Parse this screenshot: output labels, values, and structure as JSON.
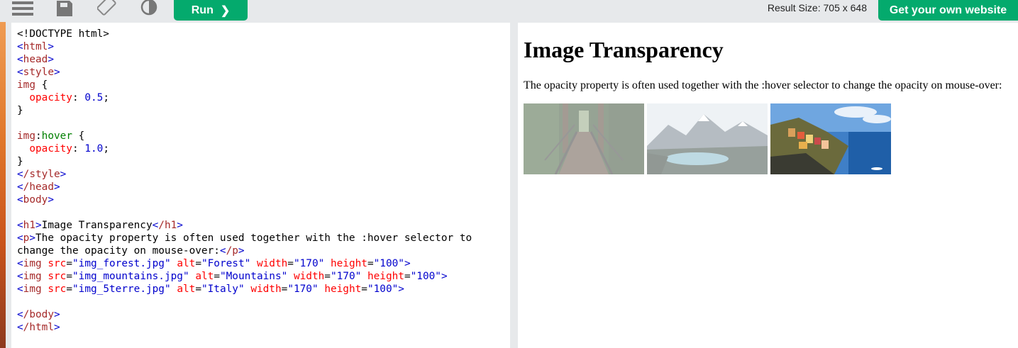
{
  "toolbar": {
    "icons": [
      "menu-icon",
      "save-icon",
      "rotate-icon",
      "contrast-icon"
    ],
    "run_label": "Run",
    "result_size": "Result Size: 705 x 648",
    "get_website_label": "Get your own website"
  },
  "editor": {
    "lines": {
      "l1": "<!DOCTYPE html>",
      "l2_tag": "html",
      "l3_tag": "head",
      "l4_tag": "style",
      "l5_sel": "img",
      "l6_prop": "opacity",
      "l6_val": "0.5",
      "l9_sel": "img",
      "l9_pseudo": "hover",
      "l10_prop": "opacity",
      "l10_val": "1.0",
      "l12_tag": "/style",
      "l13_tag": "/head",
      "l14_tag": "body",
      "l16_text": "Image Transparency",
      "l17_text": "The opacity property is often used together with the :hover selector to",
      "l18_text": "change the opacity on mouse-over:",
      "img1_src": "\"img_forest.jpg\"",
      "img1_alt": "\"Forest\"",
      "img2_src": "\"img_mountains.jpg\"",
      "img2_alt": "\"Mountains\"",
      "img3_src": "\"img_5terre.jpg\"",
      "img3_alt": "\"Italy\"",
      "img_w": "\"170\"",
      "img_h": "\"100\"",
      "l23_tag": "/body",
      "l24_tag": "/html"
    }
  },
  "result": {
    "heading": "Image Transparency",
    "paragraph": "The opacity property is often used together with the :hover selector to change the opacity on mouse-over:",
    "images": [
      {
        "alt": "Forest",
        "opacity": 0.5
      },
      {
        "alt": "Mountains",
        "opacity": 0.5
      },
      {
        "alt": "Italy",
        "opacity": 1.0
      }
    ]
  },
  "colors": {
    "accent": "#04aa6d",
    "toolbar_bg": "#e7e9eb"
  }
}
